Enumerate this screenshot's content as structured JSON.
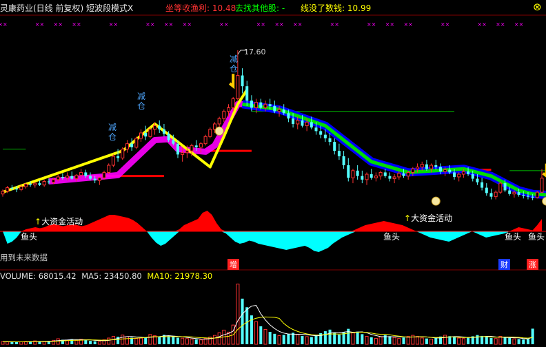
{
  "header": {
    "title": "灵康药业(日线 前复权) 短波段模式X",
    "indicator_a_label": "坐等收渔利: ",
    "indicator_a_value": "10.48",
    "indicator_b_label": "去找其他股: ",
    "indicator_b_value": "-",
    "indicator_c_label": "线没了数钱: ",
    "indicator_c_value": "10.99",
    "close_glyph": "⊗"
  },
  "annotations": {
    "peak_price": "17.60",
    "reduce_label": "减",
    "reduce_label_2": "仓",
    "big_fund_activity": "大资金活动",
    "fish_head": "鱼头",
    "future_data_note": "用到未来数据",
    "marker_add": "增",
    "marker_finance": "财",
    "marker_rise": "涨"
  },
  "volume_header": {
    "volume_label": "VOLUME: ",
    "volume_value": "68015.42",
    "ma5_label": "MA5: ",
    "ma5_value": "23450.80",
    "ma10_label": "MA10: ",
    "ma10_value": "21978.30"
  },
  "colors": {
    "up": "#ff3232",
    "down": "#54ffff",
    "ma_yellow": "#ffff00",
    "ma_magenta": "#ff00ff",
    "ribbon_blue": "#0000ff",
    "ribbon_green": "#00dd00",
    "ribbon_red": "#ff0000",
    "fund_red": "#ff0000",
    "fund_cyan": "#00ffff",
    "text_yellow": "#ffff00",
    "text_red": "#ff3232",
    "text_green": "#00ff00",
    "text_blue": "#4fa7ff"
  },
  "chart_data": {
    "type": "candlestick",
    "y_range": [
      8.9,
      18.1
    ],
    "peak_close": 17.6,
    "ohlc": [
      [
        9.6,
        9.85,
        9.45,
        9.75
      ],
      [
        9.75,
        10.05,
        9.65,
        9.95
      ],
      [
        9.95,
        10.1,
        9.8,
        9.9
      ],
      [
        9.9,
        10.05,
        9.7,
        9.85
      ],
      [
        9.85,
        10.1,
        9.75,
        10.0
      ],
      [
        10.0,
        10.2,
        9.9,
        10.15
      ],
      [
        10.15,
        10.3,
        10.0,
        10.1
      ],
      [
        10.1,
        10.25,
        9.95,
        10.2
      ],
      [
        10.2,
        10.35,
        10.05,
        10.1
      ],
      [
        10.1,
        10.4,
        10.0,
        10.3
      ],
      [
        10.3,
        10.45,
        10.15,
        10.25
      ],
      [
        10.25,
        10.5,
        10.15,
        10.4
      ],
      [
        10.4,
        10.7,
        10.3,
        10.55
      ],
      [
        10.55,
        10.75,
        10.4,
        10.5
      ],
      [
        10.5,
        10.8,
        10.35,
        10.6
      ],
      [
        10.6,
        10.85,
        10.4,
        10.45
      ],
      [
        10.45,
        10.7,
        10.3,
        10.65
      ],
      [
        10.65,
        11.0,
        10.5,
        10.8
      ],
      [
        10.8,
        10.95,
        10.5,
        10.6
      ],
      [
        10.6,
        10.8,
        10.35,
        10.45
      ],
      [
        10.45,
        10.6,
        10.2,
        10.35
      ],
      [
        10.35,
        10.55,
        10.1,
        10.5
      ],
      [
        10.5,
        10.9,
        10.4,
        10.8
      ],
      [
        10.8,
        11.3,
        10.7,
        11.2
      ],
      [
        11.2,
        11.8,
        11.1,
        11.7
      ],
      [
        11.7,
        12.1,
        11.4,
        11.6
      ],
      [
        11.6,
        12.2,
        11.5,
        12.1
      ],
      [
        12.1,
        12.6,
        11.9,
        12.4
      ],
      [
        12.4,
        12.7,
        12.0,
        12.2
      ],
      [
        12.2,
        12.8,
        12.1,
        12.7
      ],
      [
        12.7,
        13.2,
        12.5,
        13.0
      ],
      [
        13.0,
        13.4,
        12.6,
        12.8
      ],
      [
        12.8,
        13.3,
        12.7,
        13.2
      ],
      [
        13.2,
        13.6,
        12.9,
        13.4
      ],
      [
        13.4,
        13.7,
        13.0,
        13.2
      ],
      [
        13.2,
        13.5,
        12.8,
        12.95
      ],
      [
        12.95,
        13.1,
        12.5,
        12.6
      ],
      [
        12.6,
        12.9,
        12.3,
        12.4
      ],
      [
        12.4,
        12.6,
        11.6,
        11.8
      ],
      [
        11.8,
        12.2,
        11.4,
        11.9
      ],
      [
        11.9,
        12.3,
        11.6,
        12.0
      ],
      [
        12.0,
        12.4,
        11.7,
        12.3
      ],
      [
        12.3,
        12.6,
        12.0,
        12.2
      ],
      [
        12.2,
        12.5,
        11.9,
        12.4
      ],
      [
        12.4,
        12.9,
        12.3,
        12.8
      ],
      [
        12.8,
        13.3,
        12.7,
        13.2
      ],
      [
        13.2,
        13.6,
        13.0,
        13.5
      ],
      [
        13.5,
        13.9,
        13.3,
        13.8
      ],
      [
        13.8,
        14.3,
        13.6,
        14.2
      ],
      [
        14.2,
        14.6,
        13.9,
        14.4
      ],
      [
        14.4,
        15.0,
        14.2,
        14.9
      ],
      [
        14.9,
        17.6,
        14.8,
        16.2
      ],
      [
        16.2,
        16.6,
        15.2,
        15.6
      ],
      [
        15.6,
        15.9,
        14.5,
        14.8
      ],
      [
        14.8,
        15.1,
        14.2,
        14.4
      ],
      [
        14.4,
        14.9,
        14.1,
        14.7
      ],
      [
        14.7,
        14.9,
        14.3,
        14.4
      ],
      [
        14.4,
        14.8,
        14.2,
        14.6
      ],
      [
        14.6,
        14.9,
        14.3,
        14.5
      ],
      [
        14.5,
        14.8,
        14.1,
        14.2
      ],
      [
        14.2,
        14.5,
        13.9,
        14.3
      ],
      [
        14.3,
        14.6,
        14.0,
        14.1
      ],
      [
        14.1,
        14.3,
        13.6,
        13.8
      ],
      [
        13.8,
        14.1,
        13.3,
        13.5
      ],
      [
        13.5,
        13.9,
        13.2,
        13.7
      ],
      [
        13.7,
        14.0,
        13.3,
        13.4
      ],
      [
        13.4,
        13.8,
        13.1,
        13.6
      ],
      [
        13.6,
        13.9,
        13.2,
        13.3
      ],
      [
        13.3,
        13.6,
        12.9,
        13.1
      ],
      [
        13.1,
        13.4,
        12.7,
        12.9
      ],
      [
        12.9,
        13.2,
        12.5,
        12.7
      ],
      [
        12.7,
        13.0,
        12.3,
        12.5
      ],
      [
        12.5,
        12.7,
        11.8,
        12.0
      ],
      [
        12.0,
        12.4,
        11.5,
        11.7
      ],
      [
        11.7,
        12.0,
        11.0,
        11.2
      ],
      [
        11.2,
        11.6,
        10.3,
        10.5
      ],
      [
        10.5,
        11.0,
        10.2,
        10.9
      ],
      [
        10.9,
        11.2,
        10.4,
        10.6
      ],
      [
        10.6,
        10.9,
        10.2,
        10.4
      ],
      [
        10.4,
        10.8,
        10.1,
        10.7
      ],
      [
        10.7,
        11.0,
        10.4,
        10.5
      ],
      [
        10.5,
        10.8,
        10.3,
        10.6
      ],
      [
        10.6,
        10.9,
        10.4,
        10.8
      ],
      [
        10.8,
        11.0,
        10.5,
        10.6
      ],
      [
        10.6,
        10.8,
        10.3,
        10.45
      ],
      [
        10.45,
        10.7,
        10.2,
        10.55
      ],
      [
        10.55,
        10.85,
        10.4,
        10.75
      ],
      [
        10.75,
        11.0,
        10.5,
        10.6
      ],
      [
        10.6,
        10.9,
        10.4,
        10.8
      ],
      [
        10.8,
        11.1,
        10.6,
        11.0
      ],
      [
        11.0,
        11.3,
        10.8,
        11.1
      ],
      [
        11.1,
        11.4,
        10.9,
        11.25
      ],
      [
        11.25,
        11.5,
        10.9,
        11.0
      ],
      [
        11.0,
        11.3,
        10.8,
        11.2
      ],
      [
        11.2,
        11.5,
        10.95,
        11.1
      ],
      [
        11.1,
        11.3,
        10.7,
        10.85
      ],
      [
        10.85,
        11.1,
        10.6,
        10.95
      ],
      [
        10.95,
        11.2,
        10.7,
        10.8
      ],
      [
        10.8,
        11.0,
        10.4,
        10.55
      ],
      [
        10.55,
        10.8,
        10.3,
        10.7
      ],
      [
        10.7,
        11.0,
        10.5,
        10.85
      ],
      [
        10.85,
        11.1,
        10.6,
        10.7
      ],
      [
        10.7,
        10.9,
        10.3,
        10.45
      ],
      [
        10.45,
        10.7,
        10.1,
        10.25
      ],
      [
        10.25,
        10.5,
        9.8,
        9.95
      ],
      [
        9.95,
        10.2,
        9.5,
        9.65
      ],
      [
        9.65,
        9.9,
        9.3,
        9.45
      ],
      [
        9.45,
        9.8,
        9.3,
        9.7
      ],
      [
        9.7,
        10.3,
        9.6,
        10.2
      ],
      [
        10.2,
        10.4,
        9.7,
        9.8
      ],
      [
        9.8,
        10.0,
        9.5,
        9.6
      ],
      [
        9.6,
        9.8,
        9.4,
        9.7
      ],
      [
        9.7,
        9.9,
        9.45,
        9.55
      ],
      [
        9.55,
        9.75,
        9.35,
        9.5
      ],
      [
        9.5,
        9.7,
        9.3,
        9.45
      ],
      [
        9.45,
        9.6,
        9.25,
        9.4
      ],
      [
        9.4,
        9.75,
        9.35,
        9.7
      ],
      [
        9.7,
        10.99,
        9.65,
        10.48
      ]
    ],
    "volume": [
      3000,
      2800,
      2600,
      2500,
      2700,
      3100,
      3500,
      3800,
      2900,
      3300,
      3800,
      4400,
      6200,
      5100,
      4600,
      5800,
      4400,
      5600,
      5000,
      3800,
      3300,
      3000,
      5000,
      7000,
      9000,
      8400,
      10400,
      8600,
      7400,
      6500,
      6900,
      7400,
      11000,
      9600,
      8200,
      10600,
      9400,
      8400,
      7400,
      6900,
      6400,
      5900,
      5400,
      4900,
      6600,
      8200,
      10000,
      13000,
      16000,
      13700,
      21700,
      68015,
      51500,
      41800,
      32600,
      25600,
      20300,
      16800,
      14000,
      11800,
      9700,
      10600,
      11800,
      13000,
      11100,
      9400,
      8600,
      8200,
      10300,
      12500,
      14700,
      16500,
      12700,
      10800,
      14000,
      17400,
      12800,
      14200,
      11400,
      9000,
      7900,
      6700,
      8300,
      10200,
      9100,
      7800,
      6500,
      7600,
      8800,
      10100,
      8800,
      7100,
      6500,
      5800,
      7200,
      8700,
      10200,
      9100,
      7900,
      7000,
      6400,
      7600,
      9000,
      10400,
      9400,
      8200,
      7100,
      6400,
      9000,
      8000,
      7000,
      6100,
      5800,
      5400,
      5700,
      17600
    ],
    "ma_yellow_short": [
      [
        0,
        9.7
      ],
      [
        26,
        12.0
      ],
      [
        27,
        12.2
      ],
      [
        33,
        13.5
      ],
      [
        45,
        11.1
      ],
      [
        48,
        12.8
      ],
      [
        51,
        14.6
      ],
      [
        53,
        15.4
      ]
    ],
    "ma_magenta": [
      [
        10,
        10.3
      ],
      [
        25,
        10.65
      ],
      [
        33,
        12.6
      ],
      [
        36,
        12.65
      ],
      [
        38,
        12.1
      ],
      [
        44,
        11.95
      ],
      [
        46,
        12.3
      ],
      [
        51,
        14.6
      ],
      [
        53,
        14.6
      ]
    ],
    "ribbon_blue_green": [
      [
        52,
        14.6
      ],
      [
        60,
        14.3
      ],
      [
        70,
        13.4
      ],
      [
        80,
        11.4
      ],
      [
        88,
        10.8
      ],
      [
        100,
        11.0
      ],
      [
        106,
        10.6
      ],
      [
        112,
        9.8
      ],
      [
        115,
        9.6
      ],
      [
        118,
        9.55
      ]
    ],
    "support_lines_red": [
      {
        "x": [
          18,
          35
        ],
        "y": 10.6
      },
      {
        "x": [
          44,
          54
        ],
        "y": 12.0
      },
      {
        "x": [
          100,
          106
        ],
        "y": 10.95
      }
    ],
    "resistance_lines_green": [
      {
        "x": [
          0,
          5
        ],
        "y": 12.1
      },
      {
        "x": [
          54,
          98
        ],
        "y": 14.2
      },
      {
        "x": [
          110,
          120
        ],
        "y": 10.9
      }
    ],
    "fund_activity": [
      0,
      -0.6,
      -0.5,
      -0.3,
      0,
      0.1,
      0.15,
      0.2,
      0.15,
      0.2,
      0.3,
      0.35,
      0.3,
      0.25,
      0.3,
      0.35,
      0.3,
      0.25,
      0.3,
      0.4,
      0.5,
      0.6,
      0.7,
      0.8,
      0.8,
      0.75,
      0.7,
      0.65,
      0.55,
      0.4,
      0.2,
      0,
      -0.3,
      -0.55,
      -0.7,
      -0.6,
      -0.4,
      -0.2,
      0.1,
      0.3,
      0.4,
      0.5,
      0.6,
      0.9,
      1.0,
      0.8,
      0.4,
      0.1,
      -0.1,
      -0.3,
      -0.5,
      -0.6,
      -0.55,
      -0.45,
      -0.5,
      -0.6,
      -0.65,
      -0.7,
      -0.75,
      -0.8,
      -0.85,
      -0.9,
      -0.85,
      -0.8,
      -0.75,
      -0.7,
      -0.8,
      -0.95,
      -1.0,
      -0.9,
      -0.8,
      -0.6,
      -0.45,
      -0.3,
      -0.2,
      -0.1,
      0.1,
      0.2,
      0.3,
      0.35,
      0.4,
      0.45,
      0.5,
      0.45,
      0.4,
      0.35,
      0.3,
      0.2,
      0.1,
      0,
      -0.1,
      -0.2,
      -0.3,
      -0.35,
      -0.4,
      -0.45,
      -0.5,
      -0.4,
      -0.3,
      -0.2,
      -0.1,
      0,
      -0.1,
      -0.2,
      -0.3,
      -0.25,
      -0.2,
      -0.15,
      -0.1,
      0,
      0.1,
      0.2,
      0.15,
      0.1,
      0.05,
      0.3,
      0.6
    ]
  }
}
